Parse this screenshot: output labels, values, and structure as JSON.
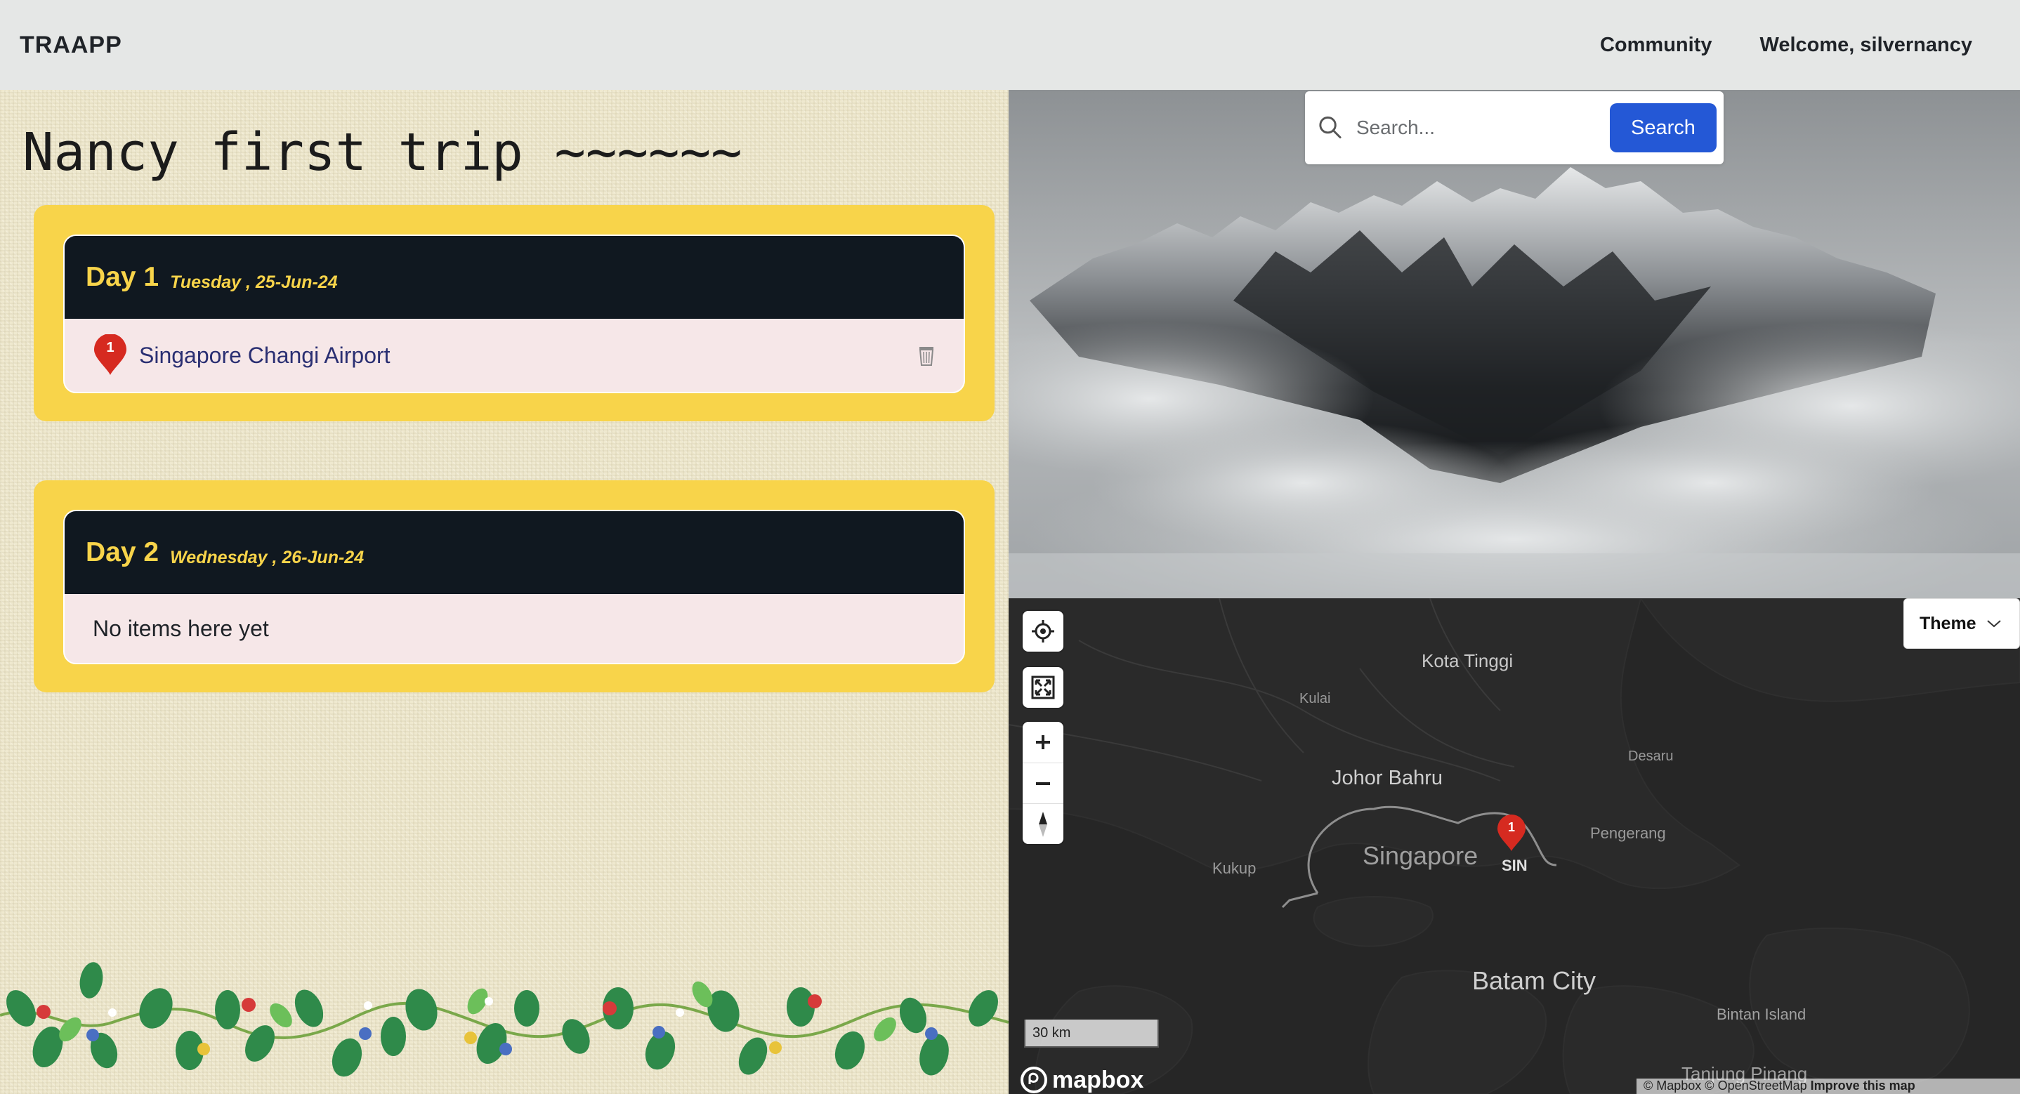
{
  "navbar": {
    "brand": "TRAAPP",
    "links": [
      "Community",
      "Welcome, silvernancy"
    ]
  },
  "trip": {
    "title": "Nancy first trip ~~~~~~",
    "days": [
      {
        "label": "Day 1",
        "date": "Tuesday , 25-Jun-24",
        "places": [
          {
            "number": "1",
            "name": "Singapore Changi Airport"
          }
        ]
      },
      {
        "label": "Day 2",
        "date": "Wednesday , 26-Jun-24",
        "empty_text": "No items here yet"
      }
    ]
  },
  "search": {
    "placeholder": "Search...",
    "button_label": "Search"
  },
  "map": {
    "theme_label": "Theme",
    "scale_label": "30 km",
    "logo_text": "mapbox",
    "attribution": "© Mapbox © OpenStreetMap",
    "attribution_link": "Improve this map",
    "marker_number": "1",
    "place_labels": {
      "kota_tinggi": "Kota Tinggi",
      "kulai": "Kulai",
      "desaru": "Desaru",
      "johor_bahru": "Johor Bahru",
      "singapore": "Singapore",
      "sin": "SIN",
      "pengerang": "Pengerang",
      "kukup": "Kukup",
      "batam_city": "Batam City",
      "bintan_island": "Bintan Island",
      "tanjung_pinang": "Tanjung Pinang"
    }
  },
  "colors": {
    "card_yellow": "#f8d44a",
    "header_dark": "#101820",
    "search_blue": "#2458d6",
    "pin_red": "#d62a20"
  }
}
